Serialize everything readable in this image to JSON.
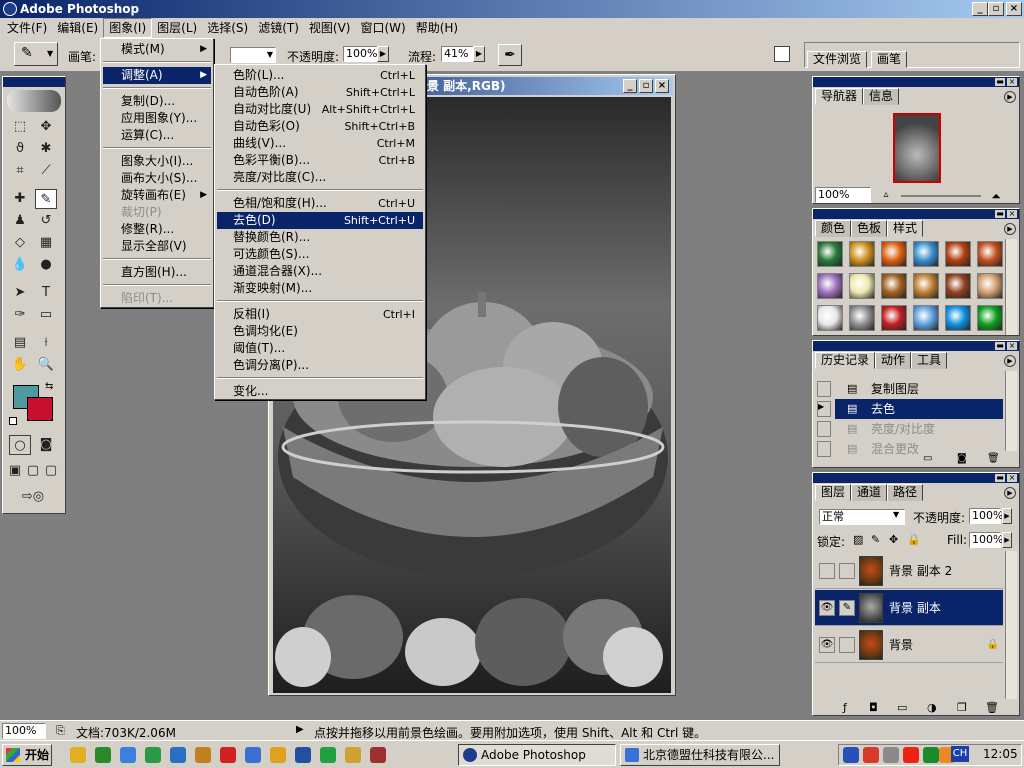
{
  "app": {
    "title": "Adobe Photoshop"
  },
  "menubar": [
    "文件(F)",
    "编辑(E)",
    "图象(I)",
    "图层(L)",
    "选择(S)",
    "滤镜(T)",
    "视图(V)",
    "窗口(W)",
    "帮助(H)"
  ],
  "options": {
    "brush_label": "画笔:",
    "opacity_label": "不透明度:",
    "opacity_value": "100%",
    "flow_label": "流程:",
    "flow_value": "41%",
    "right_tabs": [
      "文件浏览",
      "画笔"
    ]
  },
  "document": {
    "title": "景 副本,RGB)"
  },
  "image_menu": [
    {
      "label": "模式(M)",
      "arrow": true
    },
    {
      "label": "调整(A)",
      "arrow": true,
      "selected": true
    },
    {
      "label": "复制(D)..."
    },
    {
      "label": "应用图象(Y)..."
    },
    {
      "label": "运算(C)..."
    },
    {
      "label": "图象大小(I)..."
    },
    {
      "label": "画布大小(S)..."
    },
    {
      "label": "旋转画布(E)",
      "arrow": true
    },
    {
      "label": "裁切(P)",
      "disabled": true
    },
    {
      "label": "修整(R)..."
    },
    {
      "label": "显示全部(V)"
    },
    {
      "label": "直方图(H)..."
    },
    {
      "label": "陷印(T)...",
      "disabled": true
    }
  ],
  "adjust_menu": [
    {
      "label": "色阶(L)...",
      "shortcut": "Ctrl+L"
    },
    {
      "label": "自动色阶(A)",
      "shortcut": "Shift+Ctrl+L"
    },
    {
      "label": "自动对比度(U)",
      "shortcut": "Alt+Shift+Ctrl+L"
    },
    {
      "label": "自动色彩(O)",
      "shortcut": "Shift+Ctrl+B"
    },
    {
      "label": "曲线(V)...",
      "shortcut": "Ctrl+M"
    },
    {
      "label": "色彩平衡(B)...",
      "shortcut": "Ctrl+B"
    },
    {
      "label": "亮度/对比度(C)...",
      "shortcut": ""
    },
    {
      "label": "色相/饱和度(H)...",
      "shortcut": "Ctrl+U"
    },
    {
      "label": "去色(D)",
      "shortcut": "Shift+Ctrl+U",
      "selected": true
    },
    {
      "label": "替换颜色(R)...",
      "shortcut": ""
    },
    {
      "label": "可选颜色(S)...",
      "shortcut": ""
    },
    {
      "label": "通道混合器(X)...",
      "shortcut": ""
    },
    {
      "label": "渐变映射(M)...",
      "shortcut": ""
    },
    {
      "label": "反相(I)",
      "shortcut": "Ctrl+I"
    },
    {
      "label": "色调均化(E)",
      "shortcut": ""
    },
    {
      "label": "阈值(T)...",
      "shortcut": ""
    },
    {
      "label": "色调分离(P)...",
      "shortcut": ""
    },
    {
      "label": "变化...",
      "shortcut": ""
    }
  ],
  "navigator": {
    "tabs": [
      "导航器",
      "信息"
    ],
    "zoom": "100%"
  },
  "swatches": {
    "tabs": [
      "颜色",
      "色板",
      "样式"
    ]
  },
  "history": {
    "tabs": [
      "历史记录",
      "动作",
      "工具"
    ],
    "items": [
      {
        "label": "复制图层",
        "state": "normal"
      },
      {
        "label": "去色",
        "state": "selected"
      },
      {
        "label": "亮度/对比度",
        "state": "dimmed"
      },
      {
        "label": "混合更改",
        "state": "dimmed"
      }
    ]
  },
  "layers": {
    "tabs": [
      "图层",
      "通道",
      "路径"
    ],
    "blend_mode": "正常",
    "opacity_label": "不透明度:",
    "opacity_value": "100%",
    "lock_label": "锁定:",
    "fill_label": "Fill:",
    "fill_value": "100%",
    "items": [
      {
        "name": "背景 副本 2",
        "visible": false,
        "active": false
      },
      {
        "name": "背景 副本",
        "visible": true,
        "active": true
      },
      {
        "name": "背景",
        "visible": true,
        "active": false
      }
    ]
  },
  "status": {
    "zoom": "100%",
    "doc": "文档:703K/2.06M",
    "hint": "点按并拖移以用前景色绘画。要用附加选项，使用 Shift、Alt 和 Ctrl 键。"
  },
  "taskbar": {
    "start": "开始",
    "tasks": [
      "Adobe Photoshop",
      "北京德盟仕科技有限公..."
    ],
    "clock": "12:05",
    "ime": "CH"
  },
  "colors": {
    "foreground": "#4e9aa0",
    "background": "#c8102e",
    "selection": "#0a246a"
  }
}
